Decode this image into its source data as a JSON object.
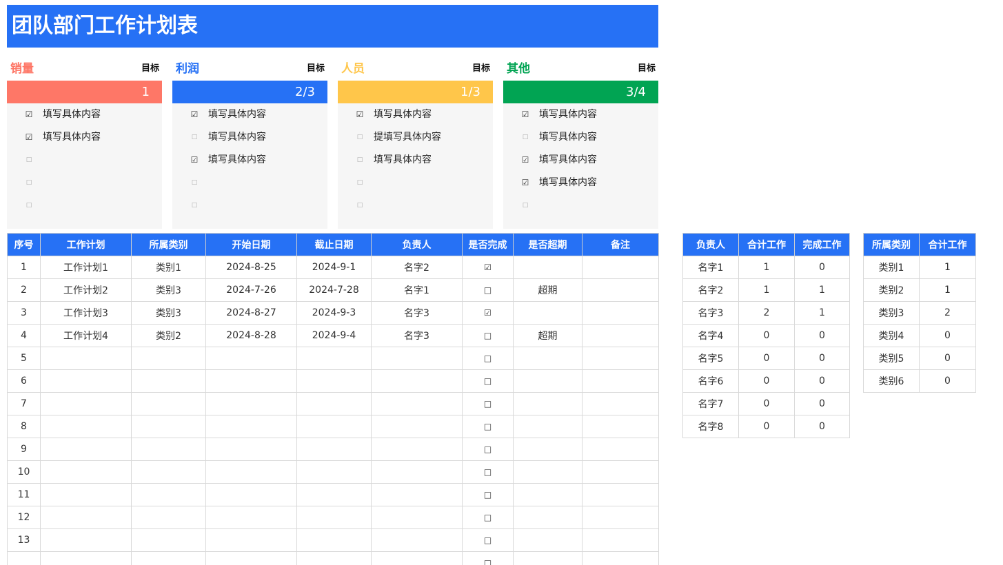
{
  "title": "团队部门工作计划表",
  "colors": {
    "primary_blue": "#2671f5",
    "sales": "#fe7767",
    "profit": "#2671f5",
    "people": "#ffc64a",
    "other": "#01a453",
    "list_bg": "#f6f6f6"
  },
  "goals": [
    {
      "name": "销量",
      "target_label": "目标",
      "ratio": "1",
      "color": "#fe7767",
      "items": [
        {
          "checked": true,
          "text": "填写具体内容"
        },
        {
          "checked": true,
          "text": "填写具体内容"
        },
        {
          "checked": false,
          "text": ""
        },
        {
          "checked": false,
          "text": ""
        },
        {
          "checked": false,
          "text": ""
        }
      ]
    },
    {
      "name": "利润",
      "target_label": "目标",
      "ratio": "2/3",
      "color": "#2671f5",
      "items": [
        {
          "checked": true,
          "text": "填写具体内容"
        },
        {
          "checked": false,
          "text": "填写具体内容"
        },
        {
          "checked": true,
          "text": "填写具体内容"
        },
        {
          "checked": false,
          "text": ""
        },
        {
          "checked": false,
          "text": ""
        }
      ]
    },
    {
      "name": "人员",
      "target_label": "目标",
      "ratio": "1/3",
      "color": "#ffc64a",
      "items": [
        {
          "checked": true,
          "text": "填写具体内容"
        },
        {
          "checked": false,
          "text": "提填写具体内容"
        },
        {
          "checked": false,
          "text": "填写具体内容"
        },
        {
          "checked": false,
          "text": ""
        },
        {
          "checked": false,
          "text": ""
        }
      ]
    },
    {
      "name": "其他",
      "target_label": "目标",
      "ratio": "3/4",
      "color": "#01a453",
      "items": [
        {
          "checked": true,
          "text": "填写具体内容"
        },
        {
          "checked": false,
          "text": "填写具体内容"
        },
        {
          "checked": true,
          "text": "填写具体内容"
        },
        {
          "checked": true,
          "text": "填写具体内容"
        },
        {
          "checked": false,
          "text": ""
        }
      ]
    }
  ],
  "main_table": {
    "headers": [
      "序号",
      "工作计划",
      "所属类别",
      "开始日期",
      "截止日期",
      "负责人",
      "是否完成",
      "是否超期",
      "备注"
    ],
    "rows": [
      {
        "no": "1",
        "plan": "工作计划1",
        "category": "类别1",
        "start": "2024-8-25",
        "end": "2024-9-1",
        "owner": "名字2",
        "done": true,
        "overdue": "",
        "note": ""
      },
      {
        "no": "2",
        "plan": "工作计划2",
        "category": "类别3",
        "start": "2024-7-26",
        "end": "2024-7-28",
        "owner": "名字1",
        "done": false,
        "overdue": "超期",
        "note": ""
      },
      {
        "no": "3",
        "plan": "工作计划3",
        "category": "类别3",
        "start": "2024-8-27",
        "end": "2024-9-3",
        "owner": "名字3",
        "done": true,
        "overdue": "",
        "note": ""
      },
      {
        "no": "4",
        "plan": "工作计划4",
        "category": "类别2",
        "start": "2024-8-28",
        "end": "2024-9-4",
        "owner": "名字3",
        "done": false,
        "overdue": "超期",
        "note": ""
      },
      {
        "no": "5",
        "plan": "",
        "category": "",
        "start": "",
        "end": "",
        "owner": "",
        "done": false,
        "overdue": "",
        "note": ""
      },
      {
        "no": "6",
        "plan": "",
        "category": "",
        "start": "",
        "end": "",
        "owner": "",
        "done": false,
        "overdue": "",
        "note": ""
      },
      {
        "no": "7",
        "plan": "",
        "category": "",
        "start": "",
        "end": "",
        "owner": "",
        "done": false,
        "overdue": "",
        "note": ""
      },
      {
        "no": "8",
        "plan": "",
        "category": "",
        "start": "",
        "end": "",
        "owner": "",
        "done": false,
        "overdue": "",
        "note": ""
      },
      {
        "no": "9",
        "plan": "",
        "category": "",
        "start": "",
        "end": "",
        "owner": "",
        "done": false,
        "overdue": "",
        "note": ""
      },
      {
        "no": "10",
        "plan": "",
        "category": "",
        "start": "",
        "end": "",
        "owner": "",
        "done": false,
        "overdue": "",
        "note": ""
      },
      {
        "no": "11",
        "plan": "",
        "category": "",
        "start": "",
        "end": "",
        "owner": "",
        "done": false,
        "overdue": "",
        "note": ""
      },
      {
        "no": "12",
        "plan": "",
        "category": "",
        "start": "",
        "end": "",
        "owner": "",
        "done": false,
        "overdue": "",
        "note": ""
      },
      {
        "no": "13",
        "plan": "",
        "category": "",
        "start": "",
        "end": "",
        "owner": "",
        "done": false,
        "overdue": "",
        "note": ""
      },
      {
        "no": "",
        "plan": "",
        "category": "",
        "start": "",
        "end": "",
        "owner": "",
        "done": false,
        "overdue": "",
        "note": ""
      }
    ]
  },
  "person_table": {
    "headers": [
      "负责人",
      "合计工作",
      "完成工作"
    ],
    "rows": [
      [
        "名字1",
        "1",
        "0"
      ],
      [
        "名字2",
        "1",
        "1"
      ],
      [
        "名字3",
        "2",
        "1"
      ],
      [
        "名字4",
        "0",
        "0"
      ],
      [
        "名字5",
        "0",
        "0"
      ],
      [
        "名字6",
        "0",
        "0"
      ],
      [
        "名字7",
        "0",
        "0"
      ],
      [
        "名字8",
        "0",
        "0"
      ]
    ]
  },
  "category_table": {
    "headers": [
      "所属类别",
      "合计工作"
    ],
    "rows": [
      [
        "类别1",
        "1"
      ],
      [
        "类别2",
        "1"
      ],
      [
        "类别3",
        "2"
      ],
      [
        "类别4",
        "0"
      ],
      [
        "类别5",
        "0"
      ],
      [
        "类别6",
        "0"
      ]
    ]
  }
}
